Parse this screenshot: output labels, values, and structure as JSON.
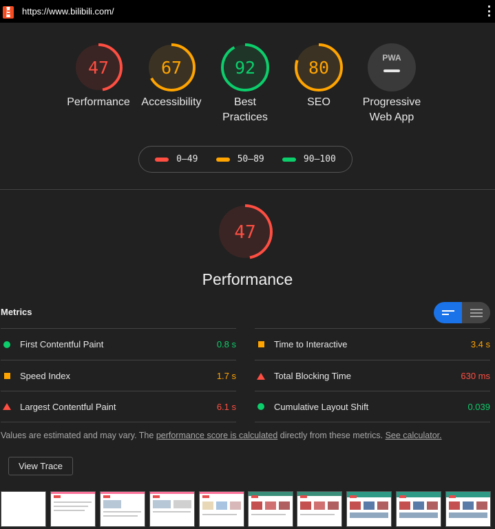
{
  "browser": {
    "url": "https://www.bilibili.com/"
  },
  "gauges": [
    {
      "id": "performance",
      "score": "47",
      "label": "Performance",
      "color": "#ff4e42",
      "fill": 0.47
    },
    {
      "id": "accessibility",
      "score": "67",
      "label": "Accessibility",
      "color": "#ffa400",
      "fill": 0.67
    },
    {
      "id": "best-practices",
      "score": "92",
      "label": "Best Practices",
      "label_line1": "Best",
      "label_line2": "Practices",
      "color": "#0cce6b",
      "fill": 0.92
    },
    {
      "id": "seo",
      "score": "80",
      "label": "SEO",
      "color": "#ffa400",
      "fill": 0.8
    },
    {
      "id": "pwa",
      "score": "",
      "badge": "PWA",
      "label": "Progressive Web App",
      "label_line1": "Progressive",
      "label_line2": "Web App",
      "color": "#9e9e9e"
    }
  ],
  "legend": [
    {
      "range": "0–49",
      "color": "#ff4e42"
    },
    {
      "range": "50–89",
      "color": "#ffa400"
    },
    {
      "range": "90–100",
      "color": "#0cce6b"
    }
  ],
  "performance": {
    "score": "47",
    "fill": 0.47,
    "title": "Performance"
  },
  "metrics": {
    "header": "Metrics",
    "items": [
      {
        "label": "First Contentful Paint",
        "value": "0.8 s",
        "status": "pass",
        "color": "#0cce6b"
      },
      {
        "label": "Time to Interactive",
        "value": "3.4 s",
        "status": "average",
        "color": "#ffa400"
      },
      {
        "label": "Speed Index",
        "value": "1.7 s",
        "status": "average",
        "color": "#ffa400"
      },
      {
        "label": "Total Blocking Time",
        "value": "630 ms",
        "status": "fail",
        "color": "#ff4e42"
      },
      {
        "label": "Largest Contentful Paint",
        "value": "6.1 s",
        "status": "fail",
        "color": "#ff4e42"
      },
      {
        "label": "Cumulative Layout Shift",
        "value": "0.039",
        "status": "pass",
        "color": "#0cce6b"
      }
    ]
  },
  "note": {
    "prefix": "Values are estimated and may vary. The ",
    "link1": "performance score is calculated",
    "middle": " directly from these metrics. ",
    "link2": "See calculator."
  },
  "view_trace_label": "View Trace"
}
